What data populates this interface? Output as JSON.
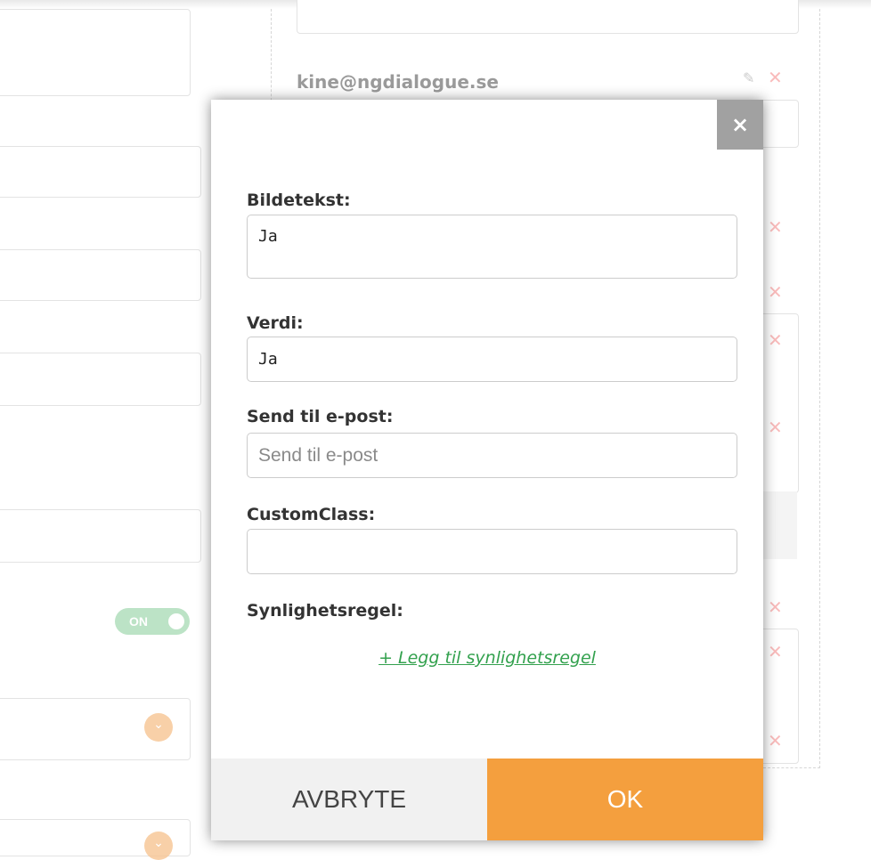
{
  "background": {
    "email": "kine@ngdialogue.se",
    "toggle_label": "ON",
    "icons": {
      "delete": "close-icon",
      "edit": "pencil-icon",
      "dropdown": "chevron-down-icon"
    }
  },
  "modal": {
    "close_label": "×",
    "fields": {
      "bildetekst": {
        "label": "Bildetekst:",
        "value": "Ja"
      },
      "verdi": {
        "label": "Verdi:",
        "value": "Ja"
      },
      "send_til": {
        "label": "Send til e-post:",
        "value": "",
        "placeholder": "Send til e-post"
      },
      "customclass": {
        "label": "CustomClass:",
        "value": ""
      }
    },
    "visibility_rule_label": "Synlighetsregel:",
    "add_rule_link": "+ Legg til synlighetsregel",
    "cancel_label": "AVBRYTE",
    "ok_label": "OK"
  },
  "colors": {
    "accent": "#f49f3e",
    "link": "#33a14e",
    "delete": "#f26b6b",
    "toggle_on": "#7bc98f"
  }
}
